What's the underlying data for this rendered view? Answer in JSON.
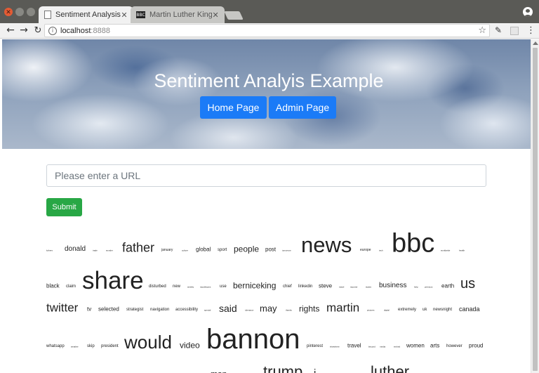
{
  "window": {
    "tabs": [
      {
        "title": "Sentiment Analysis",
        "favicon": "page-icon",
        "active": true
      },
      {
        "title": "Martin Luther King",
        "favicon": "bbc-icon",
        "active": false
      }
    ],
    "bbc_favicon_text": "BBC"
  },
  "toolbar": {
    "url_host": "localhost",
    "url_port": ":8888"
  },
  "hero": {
    "title": "Sentiment Analyis Example",
    "home_button": "Home Page",
    "admin_button": "Admin Page"
  },
  "form": {
    "url_placeholder": "Please enter a URL",
    "submit_label": "Submit"
  },
  "word_cloud": {
    "words": [
      {
        "text": "luthers",
        "size": 3
      },
      {
        "text": "donald",
        "size": 10
      },
      {
        "text": "trade",
        "size": 3
      },
      {
        "text": "wonder",
        "size": 3
      },
      {
        "text": "father",
        "size": 18
      },
      {
        "text": "january",
        "size": 5
      },
      {
        "text": "culture",
        "size": 3
      },
      {
        "text": "global",
        "size": 8
      },
      {
        "text": "sport",
        "size": 6
      },
      {
        "text": "people",
        "size": 12
      },
      {
        "text": "post",
        "size": 8
      },
      {
        "text": "tomorrow",
        "size": 3
      },
      {
        "text": "news",
        "size": 31
      },
      {
        "text": "europe",
        "size": 5
      },
      {
        "text": "tech",
        "size": 3
      },
      {
        "text": "bbc",
        "size": 38
      },
      {
        "text": "worldwide",
        "size": 3
      },
      {
        "text": "health",
        "size": 3
      },
      {
        "text": "black",
        "size": 8
      },
      {
        "text": "claim",
        "size": 6
      },
      {
        "text": "share",
        "size": 35
      },
      {
        "text": "disturbed",
        "size": 6
      },
      {
        "text": "new",
        "size": 6
      },
      {
        "text": "weekly",
        "size": 3
      },
      {
        "text": "republicans",
        "size": 3
      },
      {
        "text": "use",
        "size": 6
      },
      {
        "text": "berniceking",
        "size": 12
      },
      {
        "text": "chief",
        "size": 6
      },
      {
        "text": "linkedin",
        "size": 6
      },
      {
        "text": "steve",
        "size": 8
      },
      {
        "text": "travel",
        "size": 3
      },
      {
        "text": "reporter",
        "size": 3
      },
      {
        "text": "states",
        "size": 3
      },
      {
        "text": "business",
        "size": 10
      },
      {
        "text": "help",
        "size": 3
      },
      {
        "text": "previous",
        "size": 3
      },
      {
        "text": "earth",
        "size": 8
      },
      {
        "text": "us",
        "size": 20
      },
      {
        "text": "twitter",
        "size": 17
      },
      {
        "text": "tv",
        "size": 8
      },
      {
        "text": "selected",
        "size": 8
      },
      {
        "text": "strategist",
        "size": 6
      },
      {
        "text": "navigation",
        "size": 6
      },
      {
        "text": "accessibility",
        "size": 6
      },
      {
        "text": "special",
        "size": 3
      },
      {
        "text": "said",
        "size": 14
      },
      {
        "text": "tolerance",
        "size": 3
      },
      {
        "text": "may",
        "size": 13
      },
      {
        "text": "thanks",
        "size": 3
      },
      {
        "text": "rights",
        "size": 12
      },
      {
        "text": "martin",
        "size": 17
      },
      {
        "text": "pictures",
        "size": 3
      },
      {
        "text": "digital",
        "size": 3
      },
      {
        "text": "extremely",
        "size": 6
      },
      {
        "text": "uk",
        "size": 6
      },
      {
        "text": "newsnight",
        "size": 6
      },
      {
        "text": "canada",
        "size": 9
      },
      {
        "text": "whatsapp",
        "size": 6
      },
      {
        "text": "weather",
        "size": 3
      },
      {
        "text": "skip",
        "size": 6
      },
      {
        "text": "president",
        "size": 6
      },
      {
        "text": "would",
        "size": 26
      },
      {
        "text": "video",
        "size": 12
      },
      {
        "text": "bannon",
        "size": 40
      },
      {
        "text": "pinterest",
        "size": 6
      },
      {
        "text": "elsewhere",
        "size": 3
      },
      {
        "text": "travel",
        "size": 8
      },
      {
        "text": "beyond",
        "size": 3
      },
      {
        "text": "media",
        "size": 3
      },
      {
        "text": "embed",
        "size": 3
      },
      {
        "text": "women",
        "size": 8
      },
      {
        "text": "arts",
        "size": 8
      },
      {
        "text": "however",
        "size": 6
      },
      {
        "text": "proud",
        "size": 8
      },
      {
        "text": "man",
        "size": 12
      },
      {
        "text": "trump",
        "size": 22
      },
      {
        "text": "i",
        "size": 15
      },
      {
        "text": "luther",
        "size": 22
      }
    ]
  }
}
